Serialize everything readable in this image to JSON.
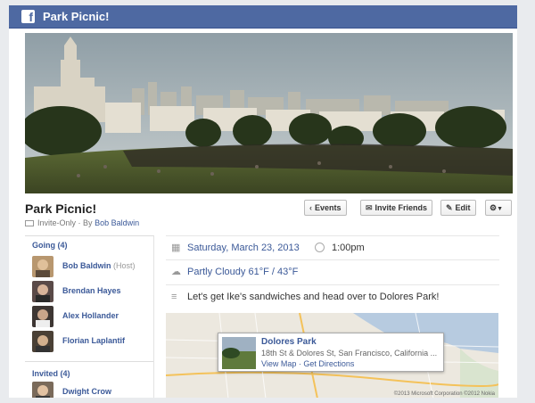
{
  "topbar": {
    "app_title": "Park Picnic!",
    "logo_letter": "f"
  },
  "event": {
    "title": "Park Picnic!",
    "privacy": "Invite-Only",
    "by_prefix": "· By",
    "host": "Bob Baldwin"
  },
  "toolbar": {
    "events_icon": "‹",
    "events_label": "Events",
    "invite_label": "Invite Friends",
    "edit_label": "Edit"
  },
  "sidebar": {
    "going_label": "Going (4)",
    "going": [
      {
        "name": "Bob Baldwin",
        "tag": "(Host)"
      },
      {
        "name": "Brendan Hayes"
      },
      {
        "name": "Alex Hollander"
      },
      {
        "name": "Florian Laplantif"
      }
    ],
    "invited_label": "Invited (4)",
    "invited": [
      {
        "name": "Dwight Crow"
      }
    ]
  },
  "details": {
    "date": "Saturday, March 23, 2013",
    "time": "1:00pm",
    "weather": "Partly Cloudy 61°F / 43°F",
    "description": "Let's get Ike's sandwiches and head over to Dolores Park!"
  },
  "map": {
    "place_name": "Dolores Park",
    "address": "18th St & Dolores St, San Francisco, California ...",
    "view_map": "View Map",
    "separator": "·",
    "directions": "Get Directions",
    "copyright": "©2013 Microsoft Corporation ©2012 Nokia"
  },
  "colors": {
    "brand": "#4e69a2",
    "link": "#3b5998"
  }
}
